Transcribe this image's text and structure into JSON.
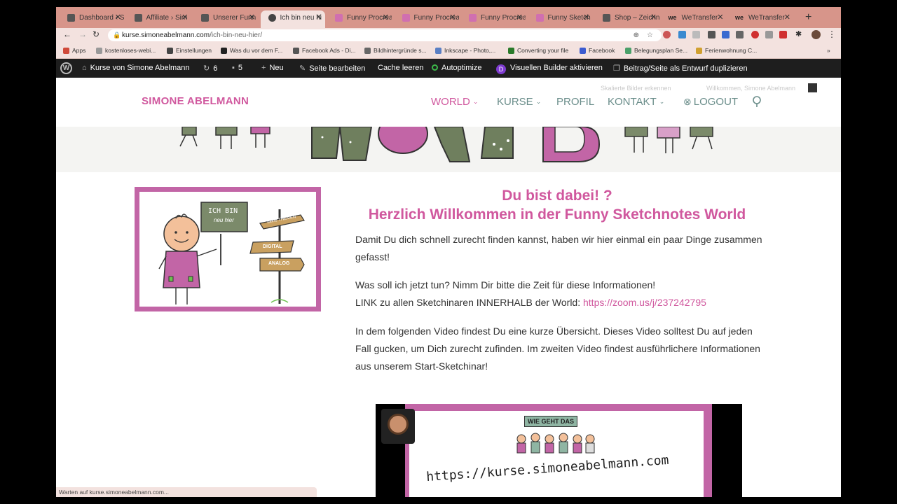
{
  "browser": {
    "tabs": [
      {
        "title": "Dashboard ‹ S",
        "fav": "wp"
      },
      {
        "title": "Affiliate › Sim",
        "fav": "wp"
      },
      {
        "title": "Unserer Funn",
        "fav": "wp"
      },
      {
        "title": "Ich bin neu hi",
        "fav": "globe",
        "active": true
      },
      {
        "title": "Funny Procrea",
        "fav": "pink"
      },
      {
        "title": "Funny Procrea",
        "fav": "pink"
      },
      {
        "title": "Funny Procrea",
        "fav": "pink"
      },
      {
        "title": "Funny Sketch",
        "fav": "pink"
      },
      {
        "title": "Shop – Zeichn",
        "fav": "wp"
      },
      {
        "title": "WeTransfer",
        "fav": "wt"
      },
      {
        "title": "WeTransfer",
        "fav": "wt"
      }
    ],
    "new_tab": "+",
    "url_domain": "kurse.simoneabelmann.com",
    "url_path": "/ich-bin-neu-hier/",
    "bookmarks": [
      {
        "label": "Apps",
        "color": "#d04a3a"
      },
      {
        "label": "kostenloses-webi...",
        "color": "#999"
      },
      {
        "label": "Einstellungen",
        "color": "#444"
      },
      {
        "label": "Was du vor dem F...",
        "color": "#222"
      },
      {
        "label": "Facebook Ads - Di...",
        "color": "#555"
      },
      {
        "label": "Bildhintergründe s...",
        "color": "#666"
      },
      {
        "label": "Inkscape - Photo,...",
        "color": "#5a7fc4"
      },
      {
        "label": "Converting your file",
        "color": "#2a7a2a"
      },
      {
        "label": "Facebook",
        "color": "#3b5bd0"
      },
      {
        "label": "Belegungsplan Se...",
        "color": "#4aa06a"
      },
      {
        "label": "Ferienwohnung C...",
        "color": "#d0a030"
      }
    ],
    "bookmarks_more": "»",
    "status_text": "Warten auf kurse.simoneabelmann.com..."
  },
  "wpbar": {
    "site_name": "Kurse von Simone Abelmann",
    "updates_count": "6",
    "comments_count": "5",
    "new_label": "Neu",
    "edit_label": "Seite bearbeiten",
    "cache_label": "Cache leeren",
    "autoptimize_label": "Autoptimize",
    "divi_label": "Visuellen Builder aktivieren",
    "duplicate_label": "Beitrag/Seite als Entwurf duplizieren"
  },
  "site": {
    "logo": "SIMONE ABELMANN",
    "top_links": {
      "scaled": "Skalierte Bilder erkennen",
      "welcome": "Willkommen, Simone Abelmann"
    },
    "nav": [
      {
        "label": "WORLD",
        "chevron": true,
        "active": true
      },
      {
        "label": "KURSE",
        "chevron": true
      },
      {
        "label": "PROFIL"
      },
      {
        "label": "KONTAKT",
        "chevron": true
      },
      {
        "label": "LOGOUT",
        "icon": "logout-icon"
      }
    ],
    "search_icon": "search-icon",
    "accent": "#d0589e",
    "nav_color": "#6a8d8a"
  },
  "content": {
    "heading1": "Du bist dabei! ?",
    "heading2": "Herzlich Willkommen in der Funny Sketchnotes World",
    "intro_sign": {
      "line1": "ICH BIN",
      "line2": "neu hier"
    },
    "signposts": [
      "deine THEMEN",
      "DIGITAL",
      "ANALOG"
    ],
    "p1": "Damit Du dich schnell zurecht finden kannst, haben wir hier einmal ein paar Dinge zusammen gefasst!",
    "p2a": "Was soll ich jetzt tun? Nimm Dir bitte die Zeit für diese Informationen!",
    "p2b_prefix": "LINK zu allen Sketchinaren INNERHALB der World: ",
    "p2b_link": "https://zoom.us/j/237242795",
    "p3": "In dem folgenden Video findest Du eine kurze Übersicht. Dieses Video solltest Du auf jeden Fall gucken, um Dich zurecht zufinden. Im zweiten Video findest ausführlichere Informationen aus unserem Start-Sketchinar!",
    "video_sign": "WIE GEHT DAS",
    "video_url": "https://kurse.simoneabelmann.com"
  }
}
